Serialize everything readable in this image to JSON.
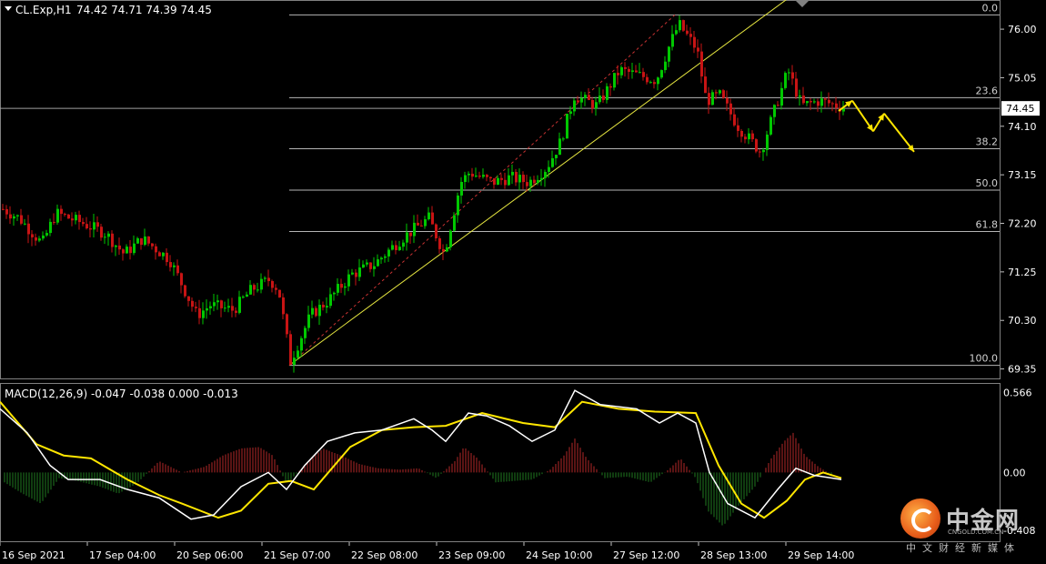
{
  "header": {
    "symbol": "CL.Exp,H1",
    "ohlc": "74.42 74.71 74.39 74.45"
  },
  "macd": {
    "label": "MACD(12,26,9) -0.047 -0.038 0.000 -0.013"
  },
  "colors": {
    "background": "#000000",
    "bull_candle": "#00c800",
    "bear_candle": "#c81414",
    "fib_line": "#b4b4b4",
    "trend_line": "#e6e640",
    "channel_line": "#c83232",
    "forecast_arrow": "#ffe600",
    "macd_main": "#ffffff",
    "macd_signal": "#ffe600",
    "hist_pos": "#b42828",
    "hist_neg": "#1f7a1f"
  },
  "chart_data": {
    "type": "candlestick",
    "price_axis": {
      "labels": [
        "76.00",
        "75.05",
        "74.10",
        "73.15",
        "72.20",
        "71.25",
        "70.30",
        "69.35"
      ],
      "current_price": "74.45",
      "ylim": [
        69.2,
        76.5
      ]
    },
    "macd_axis": {
      "labels": [
        "0.566",
        "0.00",
        "-0.408"
      ],
      "ylim": [
        -0.48,
        0.62
      ]
    },
    "time_axis": [
      "16 Sep 2021",
      "17 Sep 04:00",
      "20 Sep 06:00",
      "21 Sep 07:00",
      "22 Sep 08:00",
      "23 Sep 09:00",
      "24 Sep 10:00",
      "27 Sep 12:00",
      "28 Sep 13:00",
      "29 Sep 14:00"
    ],
    "fibonacci": {
      "high": 76.28,
      "low": 69.42,
      "levels": [
        {
          "label": "0.0",
          "price": 76.28
        },
        {
          "label": "23.6",
          "price": 74.66
        },
        {
          "label": "38.2",
          "price": 73.66
        },
        {
          "label": "50.0",
          "price": 72.85
        },
        {
          "label": "61.8",
          "price": 72.04
        },
        {
          "label": "100.0",
          "price": 69.42
        }
      ]
    },
    "path": [
      [
        0,
        72.5
      ],
      [
        20,
        72.3
      ],
      [
        45,
        71.8
      ],
      [
        60,
        72.4
      ],
      [
        90,
        72.2
      ],
      [
        115,
        72.0
      ],
      [
        135,
        71.6
      ],
      [
        155,
        71.9
      ],
      [
        185,
        71.5
      ],
      [
        215,
        70.4
      ],
      [
        230,
        70.6
      ],
      [
        255,
        70.5
      ],
      [
        275,
        70.9
      ],
      [
        295,
        71.1
      ],
      [
        305,
        70.9
      ],
      [
        318,
        69.5
      ],
      [
        340,
        70.4
      ],
      [
        360,
        70.7
      ],
      [
        385,
        71.2
      ],
      [
        410,
        71.4
      ],
      [
        440,
        71.9
      ],
      [
        470,
        72.3
      ],
      [
        487,
        71.6
      ],
      [
        505,
        73.0
      ],
      [
        515,
        73.2
      ],
      [
        540,
        73.0
      ],
      [
        560,
        73.1
      ],
      [
        580,
        73.0
      ],
      [
        600,
        73.3
      ],
      [
        615,
        73.8
      ],
      [
        630,
        74.7
      ],
      [
        655,
        74.5
      ],
      [
        680,
        75.2
      ],
      [
        700,
        75.1
      ],
      [
        720,
        75.0
      ],
      [
        735,
        75.7
      ],
      [
        745,
        76.1
      ],
      [
        765,
        75.6
      ],
      [
        775,
        74.6
      ],
      [
        790,
        74.7
      ],
      [
        810,
        74.1
      ],
      [
        835,
        73.6
      ],
      [
        850,
        74.4
      ],
      [
        865,
        75.2
      ],
      [
        880,
        74.5
      ],
      [
        900,
        74.6
      ],
      [
        930,
        74.45
      ]
    ],
    "forecast": [
      [
        922,
        74.4
      ],
      [
        937,
        74.6
      ],
      [
        960,
        74.0
      ],
      [
        972,
        74.35
      ],
      [
        1005,
        73.6
      ]
    ],
    "macd_main": [
      [
        0,
        0.45
      ],
      [
        30,
        0.28
      ],
      [
        55,
        0.05
      ],
      [
        75,
        -0.05
      ],
      [
        110,
        -0.05
      ],
      [
        140,
        -0.12
      ],
      [
        175,
        -0.18
      ],
      [
        210,
        -0.33
      ],
      [
        235,
        -0.3
      ],
      [
        265,
        -0.1
      ],
      [
        295,
        0.0
      ],
      [
        315,
        -0.12
      ],
      [
        335,
        0.05
      ],
      [
        360,
        0.22
      ],
      [
        390,
        0.28
      ],
      [
        420,
        0.3
      ],
      [
        455,
        0.38
      ],
      [
        475,
        0.3
      ],
      [
        490,
        0.22
      ],
      [
        515,
        0.42
      ],
      [
        535,
        0.4
      ],
      [
        560,
        0.33
      ],
      [
        585,
        0.22
      ],
      [
        610,
        0.3
      ],
      [
        632,
        0.58
      ],
      [
        660,
        0.48
      ],
      [
        700,
        0.45
      ],
      [
        725,
        0.35
      ],
      [
        745,
        0.42
      ],
      [
        765,
        0.35
      ],
      [
        780,
        0.0
      ],
      [
        800,
        -0.22
      ],
      [
        830,
        -0.32
      ],
      [
        855,
        -0.12
      ],
      [
        875,
        0.03
      ],
      [
        895,
        -0.02
      ],
      [
        925,
        -0.05
      ]
    ],
    "macd_signal": [
      [
        0,
        0.5
      ],
      [
        40,
        0.2
      ],
      [
        70,
        0.12
      ],
      [
        100,
        0.1
      ],
      [
        140,
        -0.05
      ],
      [
        175,
        -0.16
      ],
      [
        200,
        -0.22
      ],
      [
        240,
        -0.32
      ],
      [
        265,
        -0.27
      ],
      [
        295,
        -0.08
      ],
      [
        320,
        -0.06
      ],
      [
        345,
        -0.12
      ],
      [
        385,
        0.18
      ],
      [
        420,
        0.3
      ],
      [
        455,
        0.32
      ],
      [
        490,
        0.33
      ],
      [
        530,
        0.42
      ],
      [
        575,
        0.35
      ],
      [
        610,
        0.32
      ],
      [
        640,
        0.5
      ],
      [
        680,
        0.45
      ],
      [
        720,
        0.43
      ],
      [
        765,
        0.42
      ],
      [
        790,
        0.05
      ],
      [
        815,
        -0.22
      ],
      [
        840,
        -0.32
      ],
      [
        865,
        -0.2
      ],
      [
        885,
        -0.05
      ],
      [
        905,
        0.0
      ],
      [
        925,
        -0.04
      ]
    ],
    "macd_hist": [
      [
        5,
        -0.07
      ],
      [
        25,
        -0.15
      ],
      [
        45,
        -0.22
      ],
      [
        65,
        -0.04
      ],
      [
        85,
        -0.06
      ],
      [
        110,
        -0.1
      ],
      [
        130,
        -0.15
      ],
      [
        150,
        -0.08
      ],
      [
        175,
        0.08
      ],
      [
        200,
        0.0
      ],
      [
        225,
        0.04
      ],
      [
        245,
        0.12
      ],
      [
        265,
        0.17
      ],
      [
        285,
        0.18
      ],
      [
        300,
        0.12
      ],
      [
        315,
        -0.08
      ],
      [
        335,
        0.05
      ],
      [
        355,
        0.17
      ],
      [
        375,
        0.12
      ],
      [
        395,
        0.06
      ],
      [
        415,
        0.03
      ],
      [
        440,
        0.02
      ],
      [
        460,
        0.03
      ],
      [
        480,
        -0.04
      ],
      [
        500,
        0.08
      ],
      [
        510,
        0.18
      ],
      [
        525,
        0.1
      ],
      [
        545,
        -0.07
      ],
      [
        565,
        -0.06
      ],
      [
        585,
        -0.05
      ],
      [
        605,
        0.02
      ],
      [
        620,
        0.12
      ],
      [
        632,
        0.24
      ],
      [
        645,
        0.1
      ],
      [
        665,
        -0.04
      ],
      [
        690,
        -0.03
      ],
      [
        715,
        -0.07
      ],
      [
        735,
        0.02
      ],
      [
        748,
        0.1
      ],
      [
        765,
        -0.04
      ],
      [
        778,
        -0.27
      ],
      [
        795,
        -0.38
      ],
      [
        810,
        -0.25
      ],
      [
        830,
        -0.1
      ],
      [
        848,
        0.1
      ],
      [
        862,
        0.22
      ],
      [
        872,
        0.28
      ],
      [
        885,
        0.12
      ],
      [
        900,
        0.04
      ],
      [
        915,
        -0.02
      ]
    ]
  },
  "watermark": {
    "title": "中金网",
    "url": "CNGOLD.COM.CN",
    "subtitle": "中文财经新媒体"
  }
}
